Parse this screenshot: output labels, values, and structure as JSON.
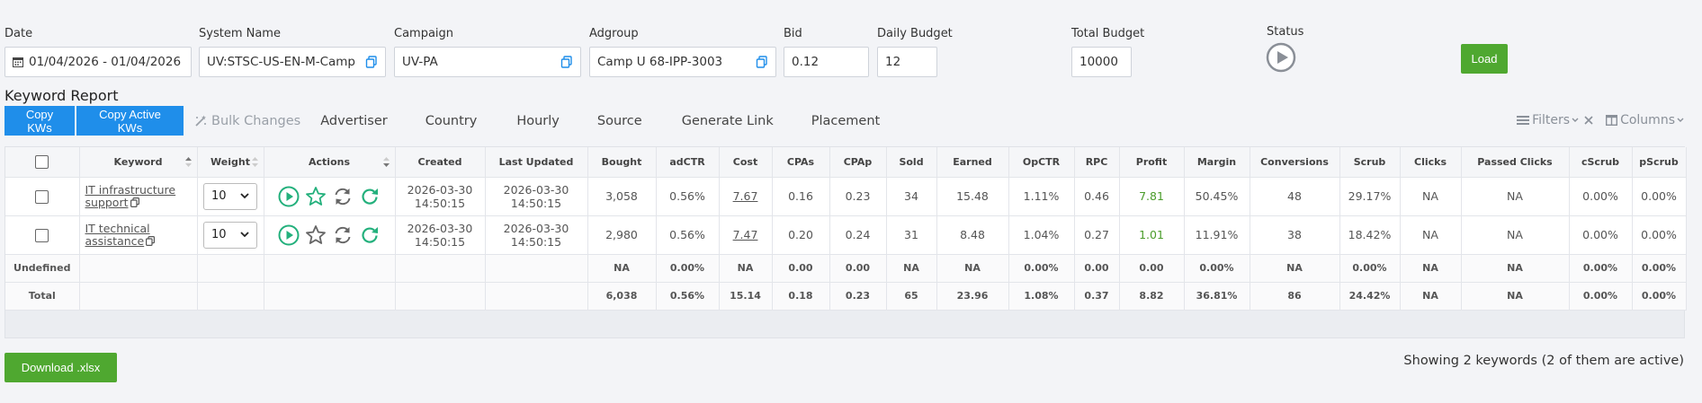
{
  "filters": {
    "date": {
      "label": "Date",
      "value": "01/04/2026 - 01/04/2026"
    },
    "system_name": {
      "label": "System Name",
      "value": "UV:STSC-US-EN-M-Camp"
    },
    "campaign": {
      "label": "Campaign",
      "value": "UV-PA"
    },
    "adgroup": {
      "label": "Adgroup",
      "value": "Camp U 68-IPP-3003"
    },
    "bid": {
      "label": "Bid",
      "value": "0.12"
    },
    "daily_budget": {
      "label": "Daily Budget",
      "value": "12"
    },
    "total_budget": {
      "label": "Total Budget",
      "value": "10000"
    },
    "status": {
      "label": "Status"
    },
    "load_label": "Load"
  },
  "report": {
    "title": "Keyword Report",
    "toolbar": {
      "copy_kws": "Copy KWs",
      "copy_active_kws": "Copy Active KWs",
      "bulk_changes": "Bulk Changes",
      "advertiser": "Advertiser",
      "country": "Country",
      "hourly": "Hourly",
      "source": "Source",
      "generate_link": "Generate Link",
      "placement": "Placement",
      "filters": "Filters",
      "columns": "Columns"
    }
  },
  "table": {
    "headers": {
      "keyword": "Keyword",
      "weight": "Weight",
      "actions": "Actions",
      "created": "Created",
      "last_updated": "Last Updated",
      "bought": "Bought",
      "adctr": "adCTR",
      "cost": "Cost",
      "cpas": "CPAs",
      "cpap": "CPAp",
      "sold": "Sold",
      "earned": "Earned",
      "opctr": "OpCTR",
      "rpc": "RPC",
      "profit": "Profit",
      "margin": "Margin",
      "conversions": "Conversions",
      "scrub": "Scrub",
      "clicks": "Clicks",
      "passed_clicks": "Passed Clicks",
      "cscrub": "cScrub",
      "pscrub": "pScrub"
    },
    "rows": [
      {
        "keyword_line1": "IT infrastructure",
        "keyword_line2": "support",
        "weight": "10",
        "starred": true,
        "created_date": "2026-03-30",
        "created_time": "14:50:15",
        "updated_date": "2026-03-30",
        "updated_time": "14:50:15",
        "bought": "3,058",
        "adctr": "0.56%",
        "cost": "7.67",
        "cpas": "0.16",
        "cpap": "0.23",
        "sold": "34",
        "earned": "15.48",
        "opctr": "1.11%",
        "rpc": "0.46",
        "profit": "7.81",
        "margin": "50.45%",
        "conversions": "48",
        "scrub": "29.17%",
        "clicks": "NA",
        "passed_clicks": "NA",
        "cscrub": "0.00%",
        "pscrub": "0.00%"
      },
      {
        "keyword_line1": "IT technical",
        "keyword_line2": "assistance",
        "weight": "10",
        "starred": false,
        "created_date": "2026-03-30",
        "created_time": "14:50:15",
        "updated_date": "2026-03-30",
        "updated_time": "14:50:15",
        "bought": "2,980",
        "adctr": "0.56%",
        "cost": "7.47",
        "cpas": "0.20",
        "cpap": "0.24",
        "sold": "31",
        "earned": "8.48",
        "opctr": "1.04%",
        "rpc": "0.27",
        "profit": "1.01",
        "margin": "11.91%",
        "conversions": "38",
        "scrub": "18.42%",
        "clicks": "NA",
        "passed_clicks": "NA",
        "cscrub": "0.00%",
        "pscrub": "0.00%"
      }
    ],
    "undefined_row": {
      "label": "Undefined",
      "bought": "NA",
      "adctr": "0.00%",
      "cost": "NA",
      "cpas": "0.00",
      "cpap": "0.00",
      "sold": "NA",
      "earned": "NA",
      "opctr": "0.00%",
      "rpc": "0.00",
      "profit": "0.00",
      "margin": "0.00%",
      "conversions": "NA",
      "scrub": "0.00%",
      "clicks": "NA",
      "passed_clicks": "NA",
      "cscrub": "0.00%",
      "pscrub": "0.00%"
    },
    "total_row": {
      "label": "Total",
      "bought": "6,038",
      "adctr": "0.56%",
      "cost": "15.14",
      "cpas": "0.18",
      "cpap": "0.23",
      "sold": "65",
      "earned": "23.96",
      "opctr": "1.08%",
      "rpc": "0.37",
      "profit": "8.82",
      "margin": "36.81%",
      "conversions": "86",
      "scrub": "24.42%",
      "clicks": "NA",
      "passed_clicks": "NA",
      "cscrub": "0.00%",
      "pscrub": "0.00%"
    }
  },
  "footer": {
    "download_label": "Download .xlsx",
    "showing_text": "Showing 2 keywords (2 of them are active)"
  },
  "colors": {
    "accent_green": "#4fa830",
    "accent_blue": "#1f8eea",
    "action_green": "#23b07c",
    "profit_green": "#4a9c2a"
  }
}
